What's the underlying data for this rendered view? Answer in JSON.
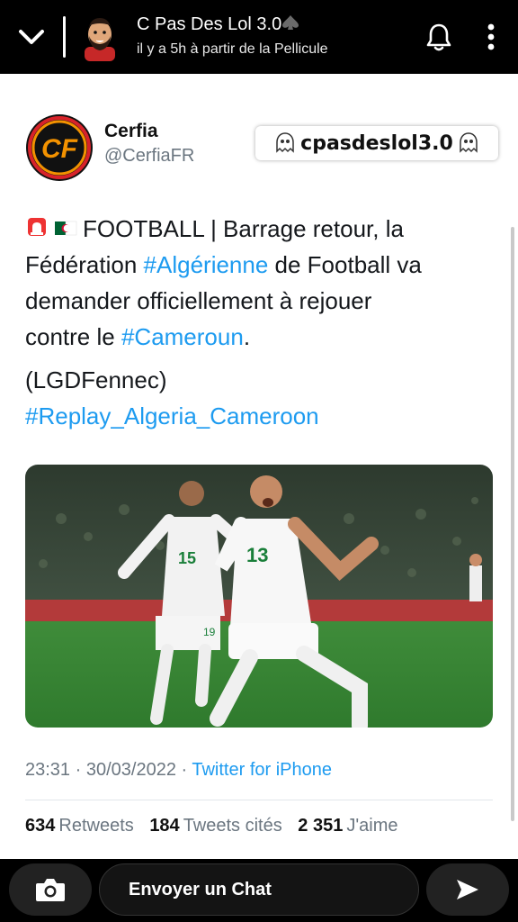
{
  "header": {
    "title": "C Pas Des Lol 3.0",
    "subtitle": "il y a 5h à partir de la Pellicule",
    "icons": [
      "chevron-down-icon",
      "bell-icon",
      "more-vertical-icon"
    ]
  },
  "tweet": {
    "author": "Cerfia",
    "handle": "@CerfiaFR",
    "logo_text": "CF",
    "watermark": "cpasdeslol3.0",
    "line1_main": "FOOTBALL | Barrage retour, la",
    "line2_pre": "Fédération ",
    "line2_hashtag": "#Algérienne",
    "line2_post": " de Football va",
    "line3": "demander officiellement à rejouer",
    "line4_pre": "contre le ",
    "line4_hashtag": "#Cameroun",
    "line4_post": ".",
    "source_credit": "(LGDFennec)",
    "hashtag_line": "#Replay_Algeria_Cameroon",
    "player_numbers": [
      "15",
      "13",
      "19"
    ],
    "time": "23:31",
    "date": "30/03/2022",
    "client": "Twitter for iPhone",
    "retweets_count": "634",
    "retweets_label": "Retweets",
    "quotes_count": "184",
    "quotes_label": "Tweets cités",
    "likes_count": "2 351",
    "likes_label": "J'aime"
  },
  "colors": {
    "hashtag": "#1d9bf0",
    "meta_text": "#6b7680",
    "logo_orange": "#f39200",
    "logo_red": "#d8232a"
  },
  "footer": {
    "chat_placeholder": "Envoyer un Chat"
  }
}
